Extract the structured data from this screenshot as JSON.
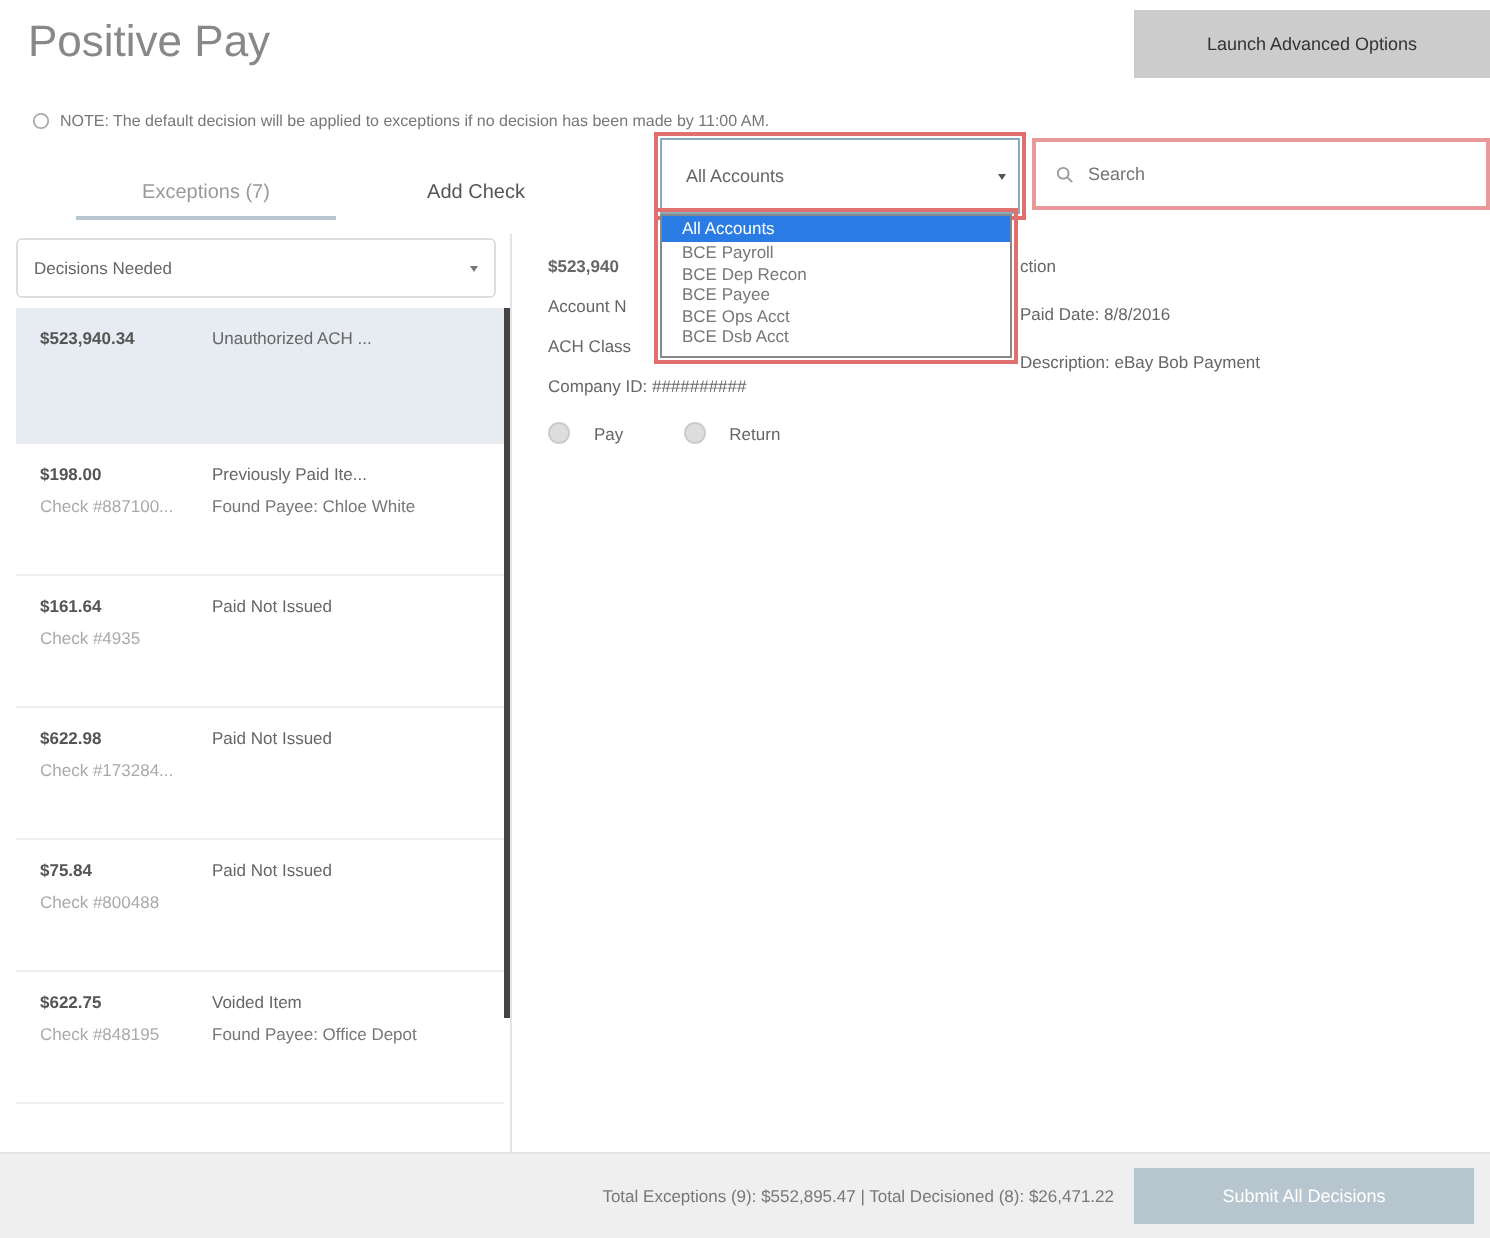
{
  "title": "Positive Pay",
  "advanced_button": "Launch Advanced Options",
  "note": "NOTE: The default decision will be applied to exceptions if no decision has been made by 11:00 AM.",
  "tabs": [
    {
      "label": "Exceptions (7)",
      "selected": true
    },
    {
      "label": "Add Check",
      "selected": false
    }
  ],
  "account_select": {
    "value": "All Accounts",
    "expanded": true,
    "options": [
      {
        "label": "All Accounts",
        "selected": true
      },
      {
        "label": "BCE Payroll",
        "selected": false
      },
      {
        "label": "BCE Dep Recon",
        "selected": false
      },
      {
        "label": "BCE Payee",
        "selected": false
      },
      {
        "label": "BCE Ops Acct",
        "selected": false
      },
      {
        "label": "BCE Dsb Acct",
        "selected": false
      }
    ]
  },
  "search": {
    "placeholder": "Search"
  },
  "filter_select": {
    "value": "Decisions Needed"
  },
  "exceptions": [
    {
      "amount": "$523,940.34",
      "reason": "Unauthorized ACH ...",
      "selected": true
    },
    {
      "amount": "$198.00",
      "check": "Check #887100...",
      "reason": "Previously Paid Ite...",
      "payee": "Found Payee: Chloe White",
      "selected": false
    },
    {
      "amount": "$161.64",
      "check": "Check #4935",
      "reason": "Paid Not Issued",
      "selected": false
    },
    {
      "amount": "$622.98",
      "check": "Check #173284...",
      "reason": "Paid Not Issued",
      "selected": false
    },
    {
      "amount": "$75.84",
      "check": "Check #800488",
      "reason": "Paid Not Issued",
      "selected": false
    },
    {
      "amount": "$622.75",
      "check": "Check #848195",
      "reason": "Voided Item",
      "payee": "Found Payee: Office Depot",
      "selected": false
    }
  ],
  "detail": {
    "left": [
      "$523,940",
      "Account N",
      "ACH Class",
      "Company ID: ##########"
    ],
    "right": [
      "ction",
      "Paid Date: 8/8/2016",
      "Description: eBay Bob Payment"
    ],
    "decisions": [
      {
        "label": "Pay",
        "selected": false
      },
      {
        "label": "Return",
        "selected": false
      }
    ]
  },
  "footer": {
    "totals": "Total Exceptions (9): $552,895.47 | Total Decisioned (8): $26,471.22",
    "submit_button": "Submit All Decisions"
  }
}
